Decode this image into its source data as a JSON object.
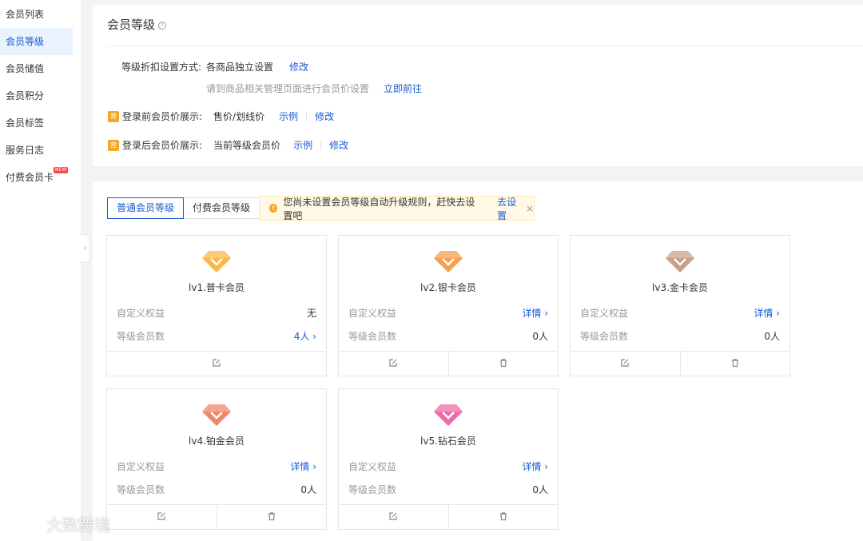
{
  "sidebar": {
    "items": [
      {
        "label": "会员列表"
      },
      {
        "label": "会员等级"
      },
      {
        "label": "会员储值"
      },
      {
        "label": "会员积分"
      },
      {
        "label": "会员标签"
      },
      {
        "label": "服务日志"
      },
      {
        "label": "付费会员卡",
        "badge": "NEW"
      }
    ],
    "collapse_glyph": "‹"
  },
  "header": {
    "title": "会员等级",
    "help_glyph": "?"
  },
  "settings": {
    "discount": {
      "label": "等级折扣设置方式:",
      "value": "各商品独立设置",
      "edit": "修改",
      "hint": "请到商品相关管理页面进行会员价设置",
      "hint_link": "立即前往"
    },
    "before_login": {
      "icon_text": "营",
      "label": "登录前会员价展示:",
      "value": "售价/划线价",
      "example": "示例",
      "edit": "修改"
    },
    "after_login": {
      "icon_text": "营",
      "label": "登录后会员价展示:",
      "value": "当前等级会员价",
      "example": "示例",
      "edit": "修改"
    }
  },
  "tabs": [
    {
      "label": "普通会员等级",
      "active": true
    },
    {
      "label": "付费会员等级",
      "active": false
    }
  ],
  "notice": {
    "icon": "!",
    "text": "您尚未设置会员等级自动升级规则，赶快去设置吧",
    "link": "去设置",
    "close": "×"
  },
  "level_labels": {
    "benefit": "自定义权益",
    "count": "等级会员数"
  },
  "levels": [
    {
      "name": "lv1.普卡会员",
      "benefit": "无",
      "count": "4人 ›",
      "gem_color": "#f7b94a",
      "benefit_link": false,
      "count_link": true,
      "deletable": false
    },
    {
      "name": "lv2.银卡会员",
      "benefit": "详情 ›",
      "count": "0人",
      "gem_color": "#f5a052",
      "benefit_link": true,
      "count_link": false,
      "deletable": true
    },
    {
      "name": "lv3.金卡会员",
      "benefit": "详情 ›",
      "count": "0人",
      "gem_color": "#c8a189",
      "benefit_link": true,
      "count_link": false,
      "deletable": true
    },
    {
      "name": "lv4.铂金会员",
      "benefit": "详情 ›",
      "count": "0人",
      "gem_color": "#f0876a",
      "benefit_link": true,
      "count_link": false,
      "deletable": true
    },
    {
      "name": "lv5.钻石会员",
      "benefit": "详情 ›",
      "count": "0人",
      "gem_color": "#f06ba8",
      "benefit_link": true,
      "count_link": false,
      "deletable": true
    }
  ],
  "watermark": "大数跨境"
}
